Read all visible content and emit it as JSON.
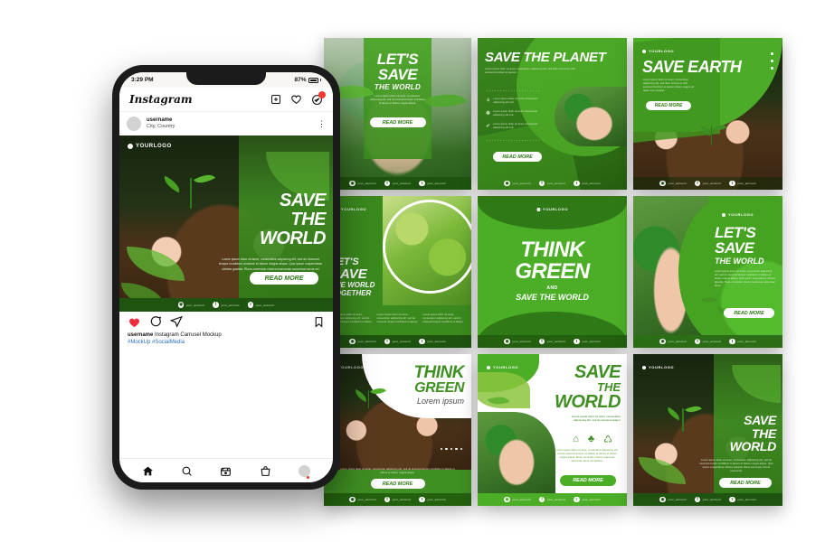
{
  "phone": {
    "status": {
      "time": "3:29 PM",
      "battery_pct": "87%"
    },
    "app": {
      "logo": "Instagram",
      "icons": {
        "add": "plus-square-icon",
        "like": "heart-icon",
        "messenger": "messenger-icon"
      },
      "badge": "1"
    },
    "post_header": {
      "username": "username",
      "location": "City, Country",
      "menu": "⋮"
    },
    "post_actions": {
      "like": "heart-filled-icon",
      "comment": "comment-icon",
      "share": "share-icon",
      "save": "bookmark-icon"
    },
    "caption": {
      "username": "username",
      "text": "Instagram Carrusel Mockup",
      "hashtags": "#MockUp #SocialMedia"
    },
    "nav": [
      "home-icon",
      "search-icon",
      "reels-icon",
      "shop-icon",
      "profile-avatar"
    ],
    "post_card": {
      "logo": "YOURLOGO",
      "headline": [
        "SAVE",
        "THE",
        "WORLD"
      ],
      "body": "Lorem ipsum dolor sit amet, consectetur adipiscing elit, sed do eiusmod tempor incididunt ut labore et dolore magna aliqua. Quis ipsum suspendisse ultrices gravida. Risus commodo viverra maecenas accumsan lacus vel facilisis.",
      "button": "READ MORE"
    }
  },
  "social_row": {
    "handle": "your_account",
    "networks": [
      "instagram-icon",
      "facebook-icon",
      "twitter-icon"
    ]
  },
  "cards": [
    {
      "id": "lets-save-the-world",
      "logo": "",
      "title_lines": [
        "LET'S",
        "SAVE"
      ],
      "subtitle": "THE WORLD",
      "body": "Lorem ipsum dolor sit amet, consectetur adipiscing elit, sed do eiusmod tempor incididunt ut labore et dolore magna aliqua.",
      "button": "READ MORE"
    },
    {
      "id": "save-the-planet",
      "logo": "",
      "title_lines": [
        "SAVE THE PLANET"
      ],
      "subtitle": "",
      "body": "Lorem ipsum dolor sit amet, consectetur adipiscing elit, sed diam nonummy nibh euismod tincidunt ut laoreet.",
      "features": [
        "Lorem ipsum dolor sit amet consectetur adipiscing elit sed",
        "Lorem ipsum dolor sit amet consectetur adipiscing elit sed",
        "Lorem ipsum dolor sit amet consectetur adipiscing elit sed"
      ],
      "feature_icons": [
        "tree-icon",
        "hand-plant-icon",
        "thumbs-up-icon"
      ],
      "button": "READ MORE"
    },
    {
      "id": "save-earth",
      "logo": "YOURLOGO",
      "title_lines": [
        "SAVE EARTH"
      ],
      "subtitle": "",
      "body": "Lorem ipsum dolor sit amet, consectetur adipiscing elit, sed diam nonummy nibh euismod tincidunt ut laoreet dolore magna ali quam erat volutpat.",
      "button": "READ MORE"
    },
    {
      "id": "lets-save-the-world-together",
      "logo": "YOURLOGO",
      "title_lines": [
        "LET'S",
        "SAVE"
      ],
      "subtitle": "THE WORLD",
      "subtitle2": "TOGETHER",
      "body": "Lorem ipsum dolor sit amet, consectetur adipiscing elit, sed do eiusmod tempor incididunt ut labore.",
      "button": ""
    },
    {
      "id": "think-green-save-the-world",
      "logo": "YOURLOGO",
      "title_lines": [
        "THINK",
        "GREEN"
      ],
      "connector": "AND",
      "subtitle": "SAVE THE WORLD",
      "body": "",
      "button": ""
    },
    {
      "id": "lets-save-the-world-hands",
      "logo": "YOURLOGO",
      "title_lines": [
        "LET'S",
        "SAVE"
      ],
      "subtitle": "THE WORLD",
      "body": "Lorem ipsum dolor sit amet, consectetur adipiscing elit, sed do eiusmod tempor incididunt ut labore et dolore magna aliqua. Quis ipsum suspendisse ultrices gravida. Risus commodo viverra maecenas accumsan lacus.",
      "button": "READ MORE"
    },
    {
      "id": "think-green-lorem",
      "logo": "YOURLOGO",
      "title_lines": [
        "THINK",
        "GREEN"
      ],
      "subtitle": "Lorem ipsum",
      "body": "Lorem ipsum dolor sit amet, consectetur adipiscing elit, sed do eiusmod tempor incididunt ut labore et dolore et dolore magna aliqua.",
      "button": "READ MORE"
    },
    {
      "id": "save-the-world-white",
      "logo": "YOURLOGO",
      "title_lines": [
        "SAVE",
        "THE",
        "WORLD"
      ],
      "subtitle": "",
      "lead": "Lorem ipsum dolor sit amet, consectetur adipiscing elit, sed do eiusmod tempor",
      "icons": [
        "eco-house-icon",
        "tree-icon",
        "recycle-icon"
      ],
      "body": "Lorem ipsum dolor sit amet, consectetur adipiscing elit, sed do eiusmod tempor incididunt ut labore et dolore magna aliqua. Risus commodo viverra maecenas accumsan lacus vel facilisis.",
      "button": "READ MORE"
    },
    {
      "id": "save-the-world-soil",
      "logo": "YOURLOGO",
      "title_lines": [
        "SAVE",
        "THE",
        "WORLD"
      ],
      "subtitle": "",
      "body": "Lorem ipsum dolor sit amet, consectetur adipiscing elit, sed do eiusmod tempor incididunt ut labore et dolore magna aliqua. Quis ipsum suspendisse ultrices gravida. Risus commodo viverra maecenas.",
      "button": "READ MORE"
    }
  ],
  "colors": {
    "bright_green": "#4CAF27",
    "mid_green": "#3f8f22",
    "dark_green": "#1f5410",
    "deep_green": "#2c6b17",
    "white": "#ffffff"
  }
}
